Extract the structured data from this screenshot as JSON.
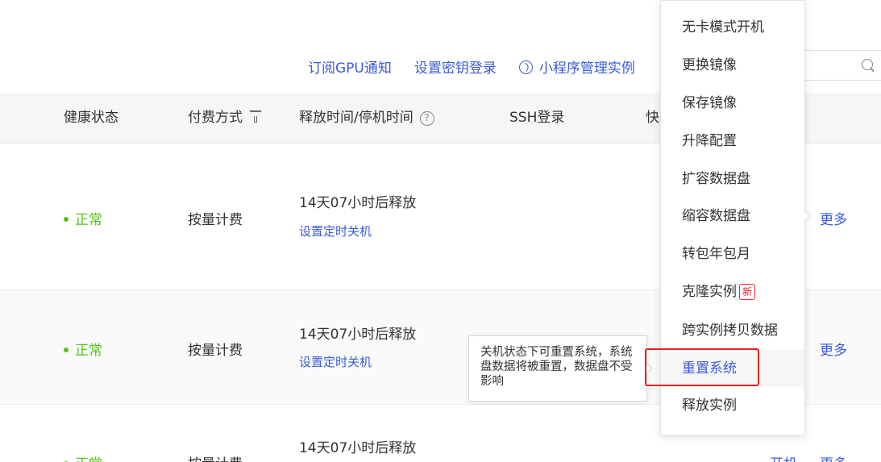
{
  "toolbar": {
    "links": [
      "订阅GPU通知",
      "设置密钥登录",
      "小程序管理实例"
    ],
    "mini_icon": "miniprogram-icon",
    "search_icon": "search-icon"
  },
  "table": {
    "headers": {
      "health": "健康状态",
      "billing": "付费方式",
      "release_time": "释放时间/停机时间",
      "ssh": "SSH登录",
      "quick_partial": "快"
    },
    "rows": [
      {
        "status": "正常",
        "billing": "按量计费",
        "release": "14天07小时后释放",
        "action": "设置定时关机",
        "more": "更多"
      },
      {
        "status": "正常",
        "billing": "按量计费",
        "release": "14天07小时后释放",
        "action": "设置定时关机",
        "more": "更多"
      },
      {
        "status": "正常",
        "billing": "按量计费",
        "release": "14天07小时后释放",
        "start": "开机",
        "more": "更多"
      }
    ]
  },
  "menu": {
    "items": [
      "无卡模式开机",
      "更换镜像",
      "保存镜像",
      "升降配置",
      "扩容数据盘",
      "缩容数据盘",
      "转包年包月",
      "克隆实例",
      "跨实例拷贝数据",
      "重置系统",
      "释放实例"
    ],
    "new_badge": "新",
    "active_item": "重置系统"
  },
  "tooltip": {
    "text": "关机状态下可重置系统，系统盘数据将被重置，数据盘不受影响"
  },
  "colors": {
    "link": "#3b5bdb",
    "status_ok": "#52c41a",
    "highlight": "#e8211d",
    "header_bg": "#f5f6f8"
  }
}
